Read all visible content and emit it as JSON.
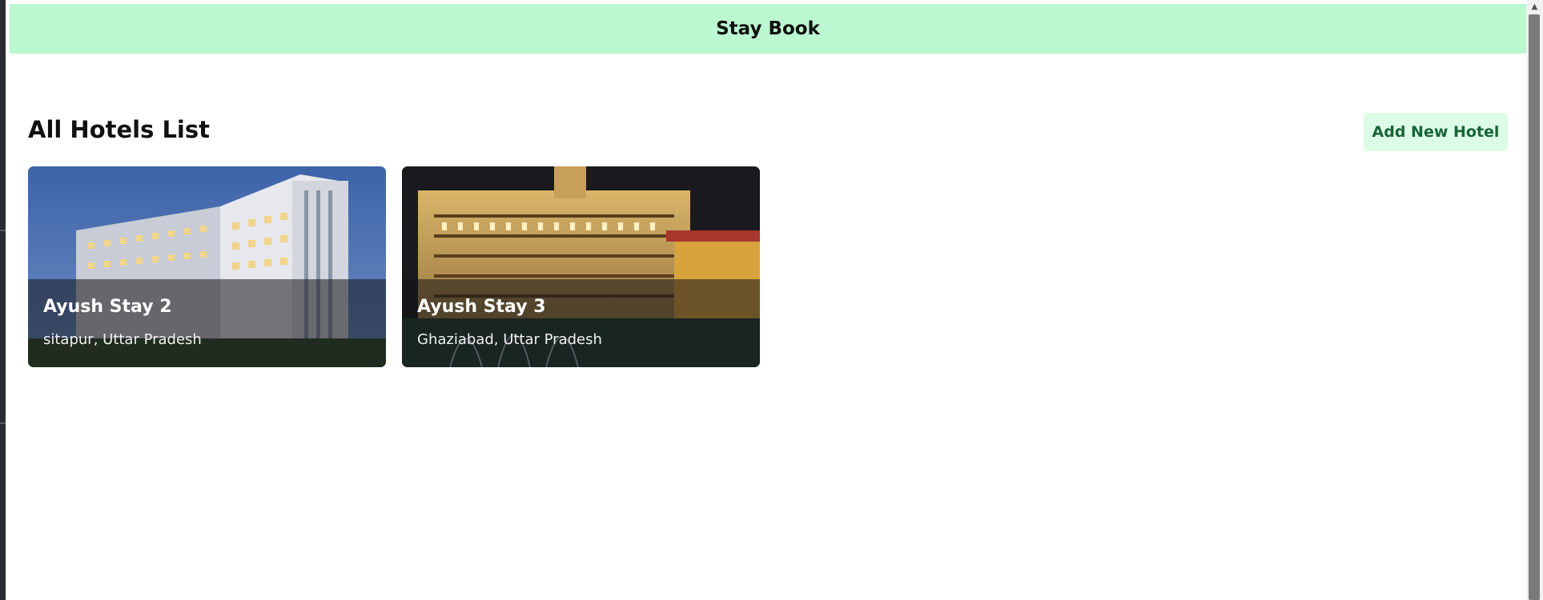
{
  "header": {
    "title": "Stay Book",
    "color": "#bbf7d0"
  },
  "main": {
    "section_title": "All Hotels List",
    "add_button_label": "Add New Hotel"
  },
  "hotels": [
    {
      "name": "Ayush Stay 2",
      "location": "sitapur, Uttar Pradesh"
    },
    {
      "name": "Ayush Stay 3",
      "location": "Ghaziabad, Uttar Pradesh"
    }
  ],
  "scrollbar": {
    "up_icon": "triangle-up-icon"
  }
}
